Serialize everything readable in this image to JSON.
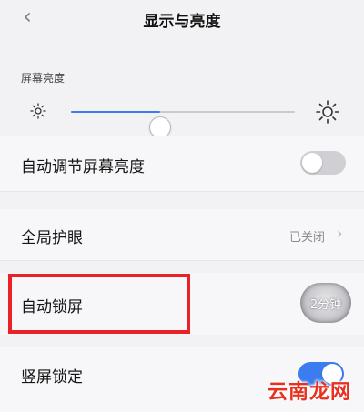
{
  "header": {
    "title": "显示与亮度"
  },
  "brightness": {
    "section_label": "屏幕亮度",
    "level_percent": 40
  },
  "rows": {
    "auto_brightness": {
      "label": "自动调节屏幕亮度",
      "enabled": false
    },
    "global_eye_care": {
      "label": "全局护眼",
      "value": "已关闭"
    },
    "auto_lock": {
      "label": "自动锁屏",
      "value": "2分钟"
    },
    "portrait_lock": {
      "label": "竖屏锁定",
      "enabled": true
    }
  },
  "colors": {
    "accent": "#3b7df0",
    "highlight": "#ea2228"
  },
  "icons": {
    "back": "chevron-left-icon",
    "sun_small": "sun-small-icon",
    "sun_large": "sun-large-icon",
    "chevron": "chevron-right-icon"
  },
  "watermark": {
    "text": "云南龙网"
  }
}
